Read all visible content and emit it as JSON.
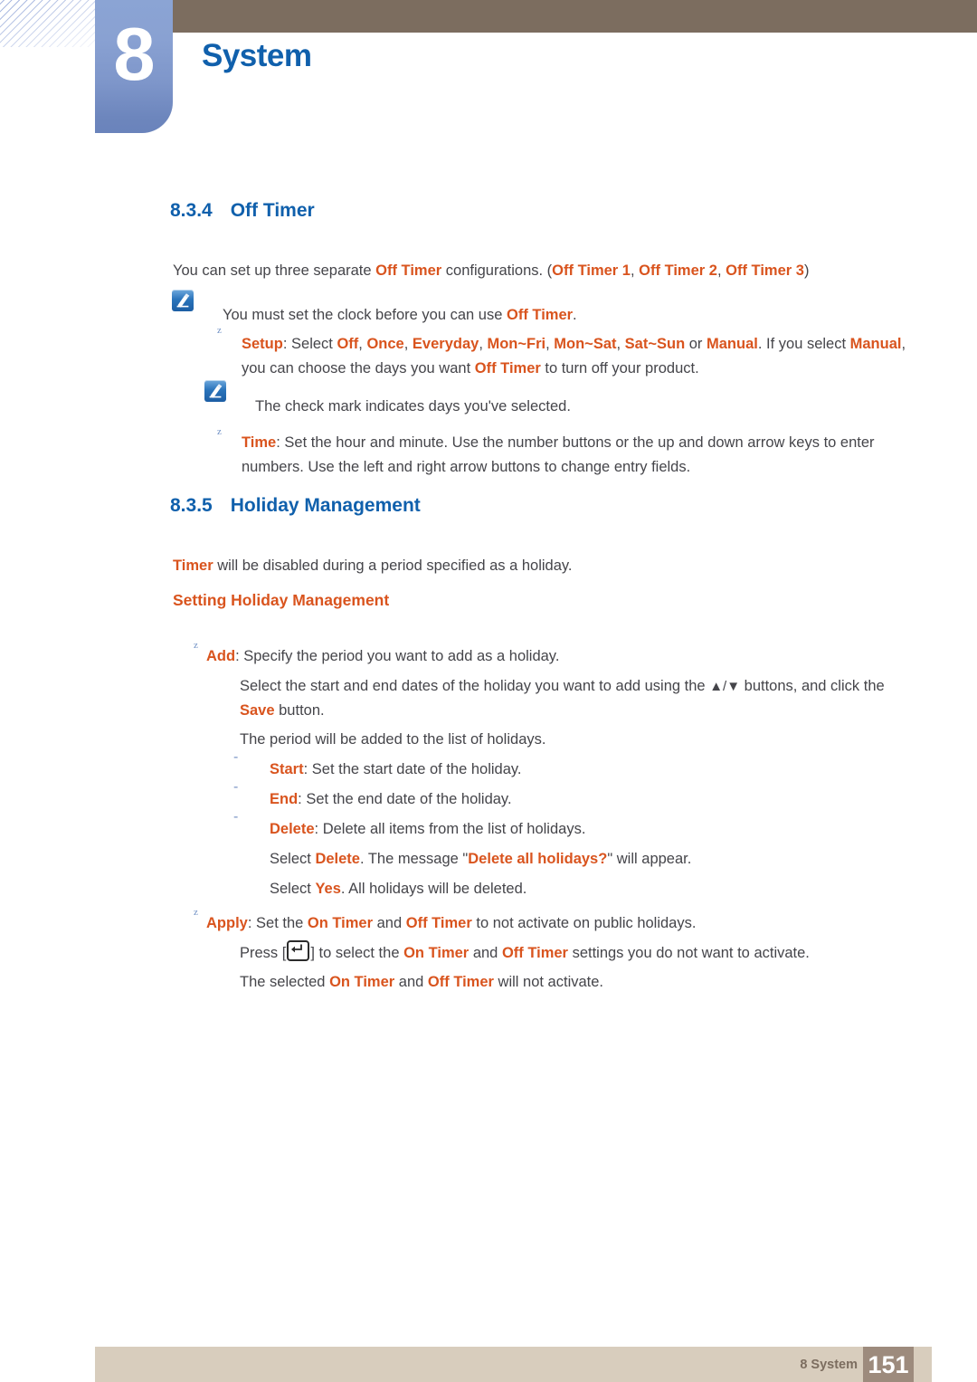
{
  "header": {
    "chapter_number": "8",
    "chapter_title": "System",
    "accent_blue": "#1060ac",
    "tab_blue": "#7e96ca",
    "bar_brown": "#7c6d5f"
  },
  "sections": {
    "off_timer": {
      "number": "8.3.4",
      "title": "Off Timer",
      "intro_pre": "You can set up three separate ",
      "intro_term": "Off Timer",
      "intro_mid": " configurations. (",
      "intro_t1": "Off Timer 1",
      "intro_sep1": ", ",
      "intro_t2": "Off Timer 2",
      "intro_sep2": ", ",
      "intro_t3": "Off Timer 3",
      "intro_end": ")",
      "note1_pre": "You must set the clock before you can use ",
      "note1_term": "Off Timer",
      "note1_end": ".",
      "setup_label": "Setup",
      "setup_pre": ": Select ",
      "setup_opt1": "Off",
      "setup_opt2": "Once",
      "setup_opt3": "Everyday",
      "setup_opt4": "Mon~Fri",
      "setup_opt5": "Mon~Sat",
      "setup_opt6": "Sat~Sun",
      "setup_or": " or ",
      "setup_opt7": "Manual",
      "setup_after": ". If you select ",
      "setup_manual2": "Manual",
      "setup_tail1": ", you can choose the days you want ",
      "setup_term2": "Off Timer",
      "setup_tail2": " to turn off your product.",
      "note2": "The check mark indicates days you've selected.",
      "time_label": "Time",
      "time_text_line1": ": Set the hour and minute. Use the number buttons or the up and down arrow keys to enter",
      "time_text_line2": "numbers. Use the left and right arrow buttons to change entry fields."
    },
    "holiday_management": {
      "number": "8.3.5",
      "title": "Holiday Management",
      "intro_term": "Timer",
      "intro_rest": " will be disabled during a period specified as a holiday.",
      "sub_heading": "Setting Holiday Management",
      "add_label": "Add",
      "add_text": ": Specify the period you want to add as a holiday.",
      "add_line1_pre": "Select the start and end dates of the holiday you want to add using the ",
      "add_line1_arrows": "▲/▼",
      "add_line1_post": " buttons, and click",
      "add_line2_pre": "the ",
      "add_line2_save": "Save",
      "add_line2_post": " button.",
      "add_line3": "The period will be added to the list of holidays.",
      "start_label": "Start",
      "start_text": ": Set the start date of the holiday.",
      "end_label": "End",
      "end_text": ": Set the end date of the holiday.",
      "delete_label": "Delete",
      "delete_text": ": Delete all items from the list of holidays.",
      "delete_line1_pre": "Select ",
      "delete_line1_term": "Delete",
      "delete_line1_mid": ". The message \"",
      "delete_line1_msg": "Delete all holidays?",
      "delete_line1_post": "\" will appear.",
      "delete_line2_pre": "Select ",
      "delete_line2_yes": "Yes",
      "delete_line2_post": ". All holidays will be deleted.",
      "apply_label": "Apply",
      "apply_pre": ": Set the ",
      "apply_on": "On Timer",
      "apply_and": " and ",
      "apply_off": "Off Timer",
      "apply_post": " to not activate on public holidays.",
      "press_pre": "Press [",
      "press_mid": "] to select the ",
      "press_on": "On Timer",
      "press_and": " and ",
      "press_off": "Off Timer",
      "press_post": " settings you do not want to activate.",
      "selected_pre": "The selected ",
      "selected_on": "On Timer",
      "selected_and": " and ",
      "selected_off": "Off Timer",
      "selected_post": " will not activate."
    }
  },
  "bullets": {
    "z_marker": "z",
    "dash_marker": "-"
  },
  "footer": {
    "label": "8 System",
    "page_number": "151",
    "bar_color": "#d8cdbd",
    "page_box_color": "#9d8b7d"
  }
}
